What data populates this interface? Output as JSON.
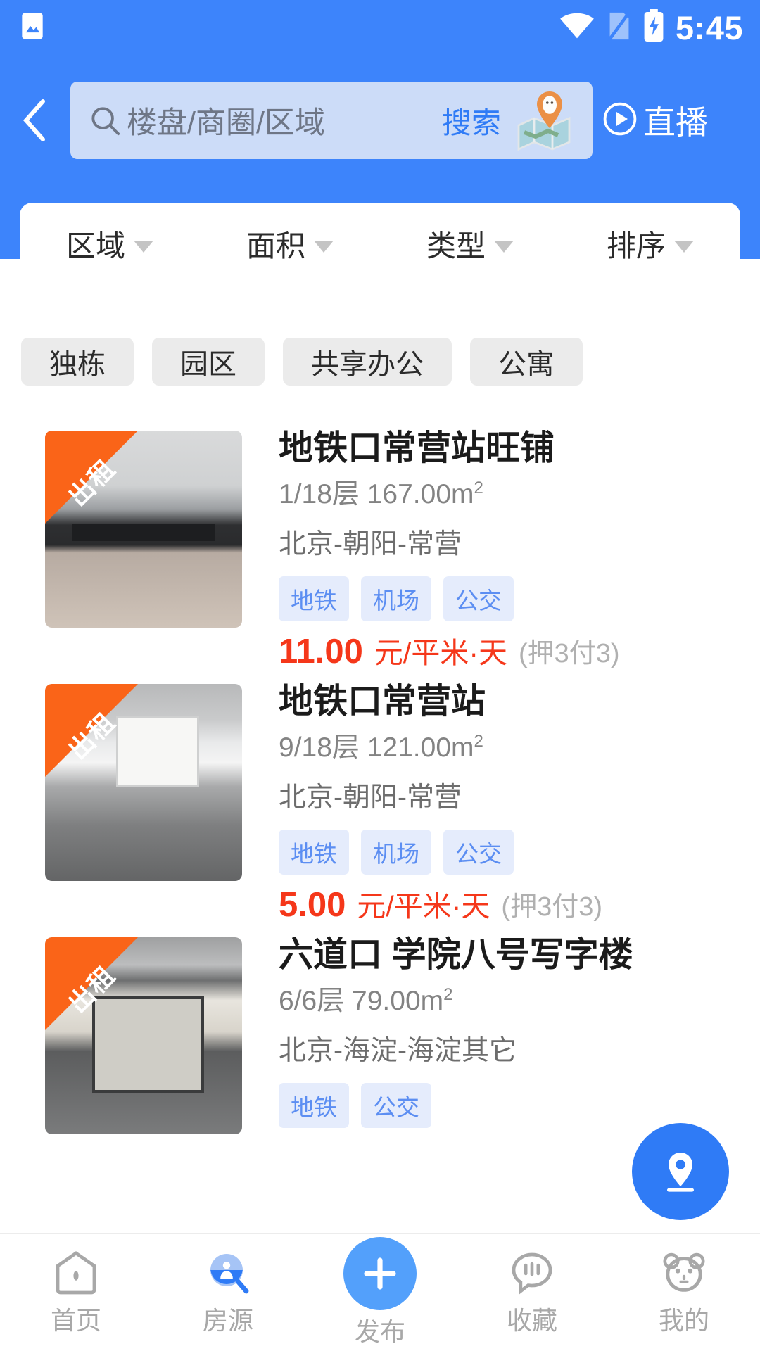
{
  "statusbar": {
    "time": "5:45",
    "icons": [
      "image-icon",
      "wifi-icon",
      "sim-card-icon",
      "battery-charging-icon"
    ]
  },
  "header": {
    "back_icon": "chevron-left-icon",
    "search": {
      "icon": "search-icon",
      "placeholder": "楼盘/商圈/区域",
      "value": "",
      "button_label": "搜索",
      "map_icon": "folded-map-pin-icon"
    },
    "live": {
      "icon": "play-circle-icon",
      "label": "直播"
    },
    "accent_color": "#3d84fb"
  },
  "filters": [
    {
      "label": "区域",
      "icon": "chevron-down-icon"
    },
    {
      "label": "面积",
      "icon": "chevron-down-icon"
    },
    {
      "label": "类型",
      "icon": "chevron-down-icon"
    },
    {
      "label": "排序",
      "icon": "chevron-down-icon"
    }
  ],
  "chips": [
    {
      "label": "独栋"
    },
    {
      "label": "园区"
    },
    {
      "label": "共享办公"
    },
    {
      "label": "公寓"
    }
  ],
  "listings": [
    {
      "badge": "出租",
      "title": "地铁口常营站旺铺",
      "floor_area": "1/18层 167.00m",
      "area_sup": "2",
      "location": "北京-朝阳-常营",
      "tags": [
        "地铁",
        "机场",
        "公交"
      ],
      "price_number": "11.00",
      "price_unit": "元/平米·天",
      "deposit": "(押3付3)",
      "photo_class": "ph1"
    },
    {
      "badge": "出租",
      "title": "地铁口常营站",
      "floor_area": "9/18层 121.00m",
      "area_sup": "2",
      "location": "北京-朝阳-常营",
      "tags": [
        "地铁",
        "机场",
        "公交"
      ],
      "price_number": "5.00",
      "price_unit": "元/平米·天",
      "deposit": "(押3付3)",
      "photo_class": "ph2"
    },
    {
      "badge": "出租",
      "title": "六道口 学院八号写字楼",
      "floor_area": "6/6层 79.00m",
      "area_sup": "2",
      "location": "北京-海淀-海淀其它",
      "tags": [
        "地铁",
        "公交"
      ],
      "price_number": "",
      "price_unit": "",
      "deposit": "",
      "photo_class": "ph3"
    }
  ],
  "map_fab": {
    "icon": "map-pin-icon",
    "color": "#2f7bf6"
  },
  "bottom_nav": [
    {
      "label": "首页",
      "icon": "home-icon",
      "active": false
    },
    {
      "label": "房源",
      "icon": "house-search-icon",
      "active": true
    },
    {
      "label": "发布",
      "icon": "plus-icon",
      "active": false
    },
    {
      "label": "收藏",
      "icon": "chat-bookmark-icon",
      "active": false
    },
    {
      "label": "我的",
      "icon": "bear-face-icon",
      "active": false
    }
  ],
  "colors": {
    "brand_blue": "#3d84fb",
    "price_red": "#f5371a",
    "badge_orange": "#fa6418",
    "tag_blue_bg": "#e5ecfc",
    "tag_blue_text": "#5c8ef2"
  }
}
